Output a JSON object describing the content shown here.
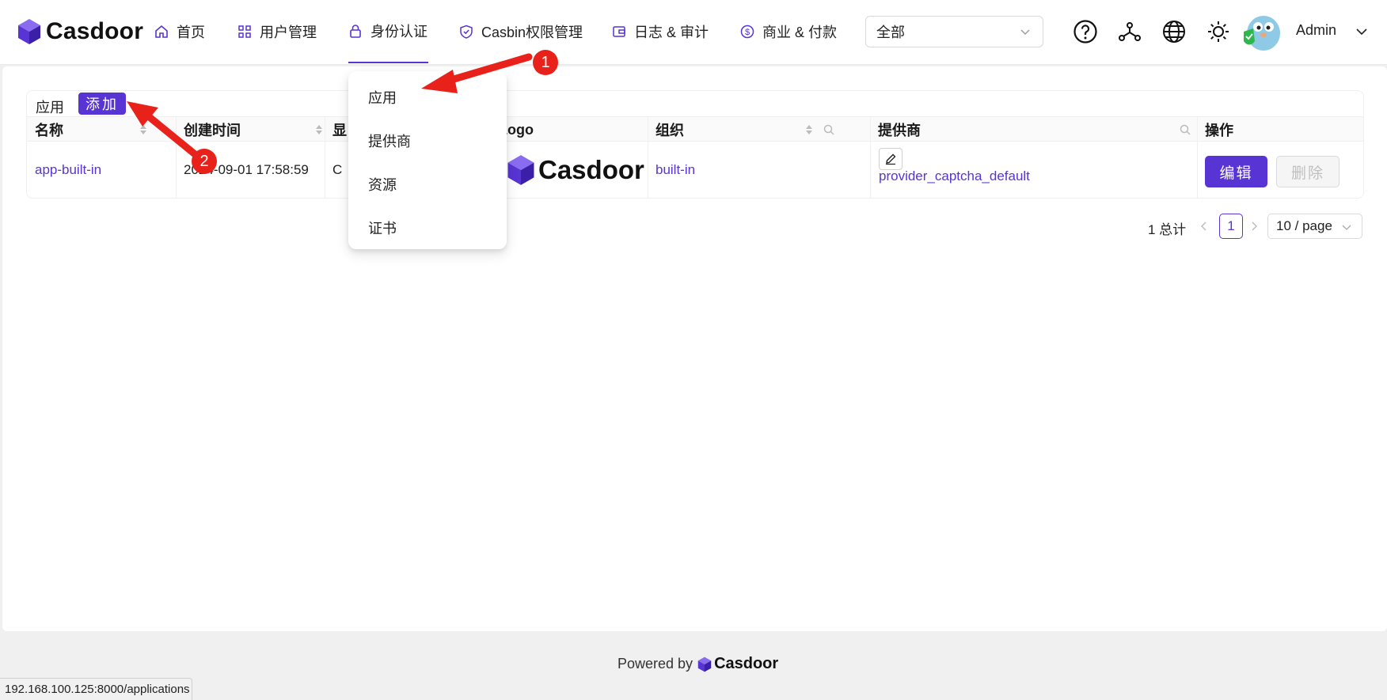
{
  "brand": {
    "name": "Casdoor"
  },
  "nav": {
    "items": [
      {
        "label": "首页",
        "icon": "home-icon"
      },
      {
        "label": "用户管理",
        "icon": "grid-icon"
      },
      {
        "label": "身份认证",
        "icon": "lock-icon",
        "active": true
      },
      {
        "label": "Casbin权限管理",
        "icon": "shield-icon"
      },
      {
        "label": "日志 & 审计",
        "icon": "wallet-icon"
      },
      {
        "label": "商业 & 付款",
        "icon": "dollar-icon"
      }
    ],
    "org_select": {
      "value": "全部"
    },
    "user": {
      "name": "Admin"
    },
    "accent": "#5734d3"
  },
  "dropdown": {
    "items": [
      "应用",
      "提供商",
      "资源",
      "证书"
    ]
  },
  "table": {
    "title": "应用",
    "add_label": "添加",
    "columns": [
      "名称",
      "创建时间",
      "显",
      "Logo",
      "组织",
      "提供商",
      "操作"
    ],
    "rows": [
      {
        "name": "app-built-in",
        "created": "2024-09-01 17:58:59",
        "display": "C",
        "logo": "Casdoor",
        "org": "built-in",
        "provider": "provider_captcha_default",
        "edit_label": "编辑",
        "delete_label": "删除"
      }
    ]
  },
  "pagination": {
    "total": "1 总计",
    "current": "1",
    "page_size": "10 / page"
  },
  "footer": {
    "powered_by": "Powered by",
    "brand": "Casdoor"
  },
  "statusbar": {
    "url": "192.168.100.125:8000/applications"
  },
  "annotations": {
    "marker1": "1",
    "marker2": "2",
    "color": "#e8221b"
  }
}
